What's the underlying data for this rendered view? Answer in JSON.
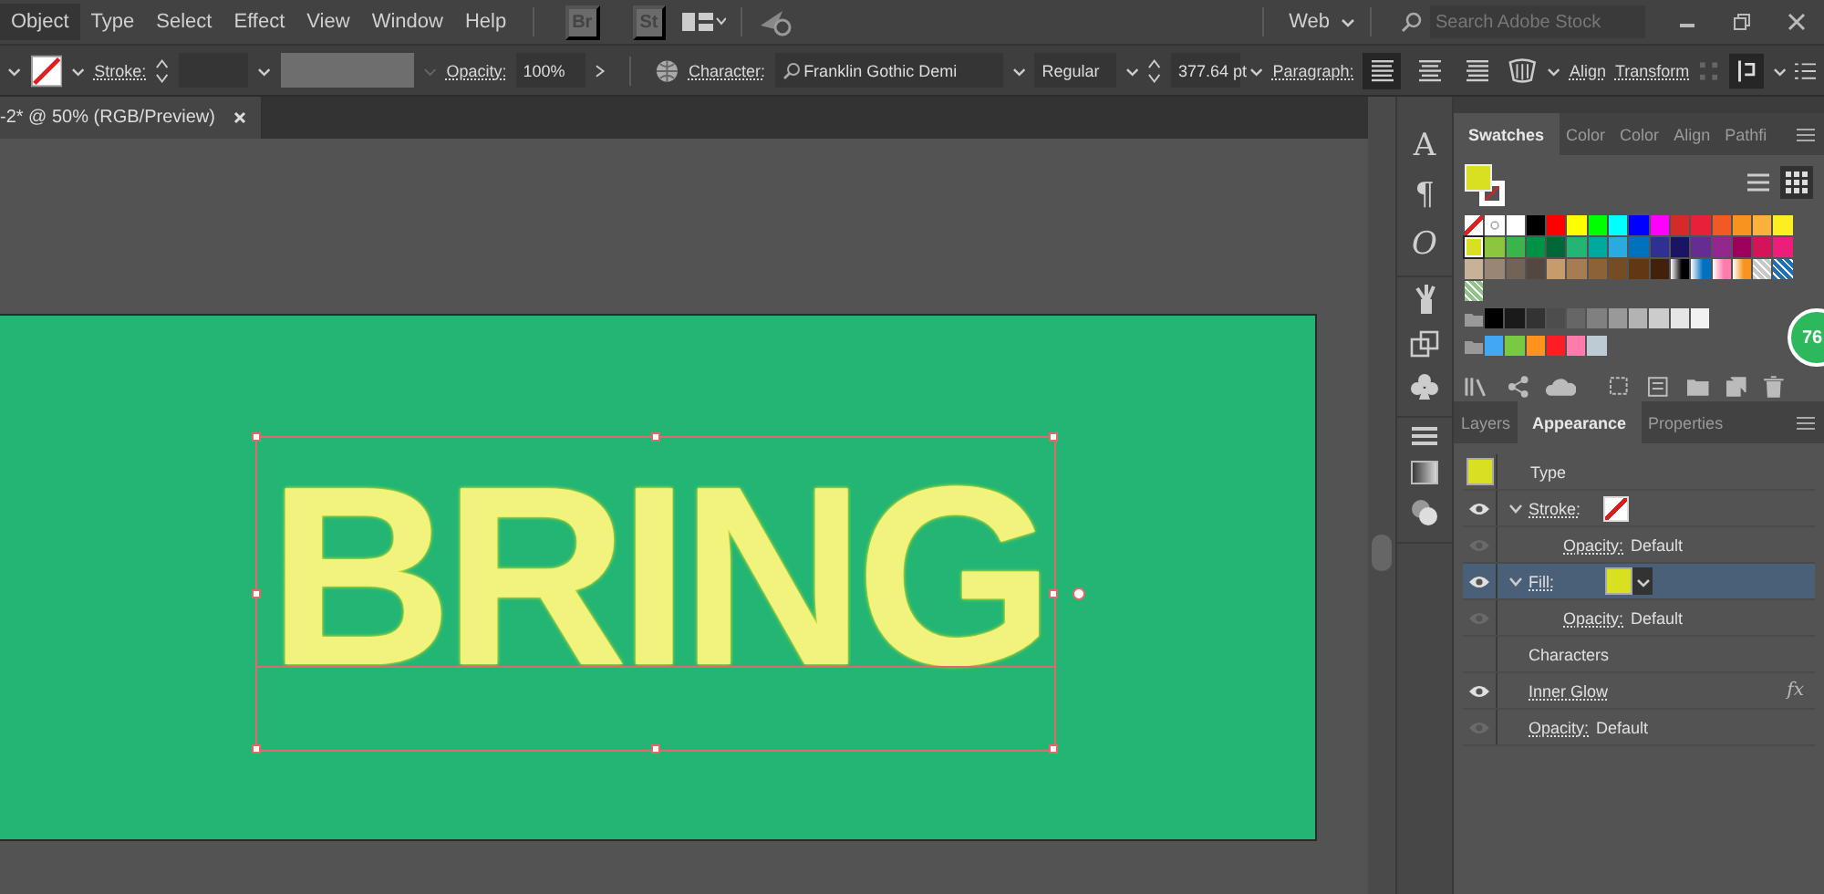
{
  "menu": [
    {
      "label": "Object",
      "selected": true
    },
    {
      "label": "Type",
      "selected": false
    },
    {
      "label": "Select",
      "selected": false
    },
    {
      "label": "Effect",
      "selected": false
    },
    {
      "label": "View",
      "selected": false
    },
    {
      "label": "Window",
      "selected": false
    },
    {
      "label": "Help",
      "selected": false
    }
  ],
  "apps": [
    "Br",
    "St"
  ],
  "workspace": "Web",
  "stock_search": {
    "placeholder": "Search Adobe Stock"
  },
  "control_bar": {
    "stroke_label": "Stroke:",
    "opacity_label": "Opacity:",
    "opacity": "100%",
    "character_label": "Character:",
    "font": "Franklin Gothic Demi",
    "style": "Regular",
    "size": "377.64 pt",
    "paragraph_label": "Paragraph:",
    "alignment": [
      {
        "selected": true
      },
      {
        "selected": false
      },
      {
        "selected": false
      }
    ],
    "align_link": "Align",
    "transform_link": "Transform"
  },
  "document_tab": {
    "title": "-2* @ 50% (RGB/Preview)"
  },
  "artboard": {
    "text": "BRING",
    "color": "#23b574"
  },
  "dock_glyphs": [
    "A",
    "¶",
    "O"
  ],
  "swatches_tabs": [
    {
      "label": "Swatches",
      "selected": true
    },
    {
      "label": "Color",
      "selected": false
    },
    {
      "label": "Color",
      "selected": false
    },
    {
      "label": "Align",
      "selected": false
    },
    {
      "label": "Pathfi",
      "selected": false
    }
  ],
  "swatches": {
    "current_fill": {
      "color": "#d9e021"
    },
    "rows": [
      {
        "folder": false,
        "swatches": [
          {
            "kind": "none",
            "selected": false
          },
          {
            "kind": "registration",
            "selected": false
          },
          {
            "kind": "color",
            "color": "#ffffff",
            "selected": false
          },
          {
            "kind": "color",
            "color": "#000000",
            "selected": false
          },
          {
            "kind": "color",
            "color": "#ff0000",
            "selected": false
          },
          {
            "kind": "color",
            "color": "#ffff00",
            "selected": false
          },
          {
            "kind": "color",
            "color": "#00ff00",
            "selected": false
          },
          {
            "kind": "color",
            "color": "#00ffff",
            "selected": false
          },
          {
            "kind": "color",
            "color": "#0000ff",
            "selected": false
          },
          {
            "kind": "color",
            "color": "#ff00ff",
            "selected": false
          },
          {
            "kind": "color",
            "color": "#d42a2a",
            "selected": false
          },
          {
            "kind": "color",
            "color": "#e8203a",
            "selected": false
          },
          {
            "kind": "color",
            "color": "#f15a24",
            "selected": false
          },
          {
            "kind": "color",
            "color": "#f7931e",
            "selected": false
          },
          {
            "kind": "color",
            "color": "#fbb03b",
            "selected": false
          },
          {
            "kind": "color",
            "color": "#fcee21",
            "selected": false
          }
        ]
      },
      {
        "folder": false,
        "swatches": [
          {
            "kind": "color",
            "color": "#d9e021",
            "selected": true
          },
          {
            "kind": "color",
            "color": "#8cc63f",
            "selected": false
          },
          {
            "kind": "color",
            "color": "#39b54a",
            "selected": false
          },
          {
            "kind": "color",
            "color": "#009245",
            "selected": false
          },
          {
            "kind": "color",
            "color": "#006837",
            "selected": false
          },
          {
            "kind": "color",
            "color": "#22b573",
            "selected": false
          },
          {
            "kind": "color",
            "color": "#00a99d",
            "selected": false
          },
          {
            "kind": "color",
            "color": "#29abe2",
            "selected": false
          },
          {
            "kind": "color",
            "color": "#0071bc",
            "selected": false
          },
          {
            "kind": "color",
            "color": "#2e3192",
            "selected": false
          },
          {
            "kind": "color",
            "color": "#1b1464",
            "selected": false
          },
          {
            "kind": "color",
            "color": "#662d91",
            "selected": false
          },
          {
            "kind": "color",
            "color": "#93278f",
            "selected": false
          },
          {
            "kind": "color",
            "color": "#9e005d",
            "selected": false
          },
          {
            "kind": "color",
            "color": "#d4145a",
            "selected": false
          },
          {
            "kind": "color",
            "color": "#ed1e79",
            "selected": false
          }
        ]
      },
      {
        "folder": false,
        "swatches": [
          {
            "kind": "color",
            "color": "#c7b299",
            "selected": false
          },
          {
            "kind": "color",
            "color": "#998675",
            "selected": false
          },
          {
            "kind": "color",
            "color": "#736357",
            "selected": false
          },
          {
            "kind": "color",
            "color": "#534741",
            "selected": false
          },
          {
            "kind": "color",
            "color": "#c69c6d",
            "selected": false
          },
          {
            "kind": "color",
            "color": "#a67c52",
            "selected": false
          },
          {
            "kind": "color",
            "color": "#8c6239",
            "selected": false
          },
          {
            "kind": "color",
            "color": "#754c24",
            "selected": false
          },
          {
            "kind": "color",
            "color": "#603813",
            "selected": false
          },
          {
            "kind": "color",
            "color": "#42210b",
            "selected": false
          },
          {
            "kind": "gradient",
            "color": "#000000",
            "selected": false
          },
          {
            "kind": "gradient",
            "color": "#0071bc",
            "selected": false
          },
          {
            "kind": "gradient",
            "color": "#ff7bac",
            "selected": false
          },
          {
            "kind": "gradient",
            "color": "#f7931e",
            "selected": false
          },
          {
            "kind": "pattern",
            "color": "#c8c8c8",
            "selected": false
          },
          {
            "kind": "pattern",
            "color": "#1f6fb8",
            "selected": false
          }
        ]
      },
      {
        "folder": false,
        "swatches": [
          {
            "kind": "pattern",
            "color": "#8fc38a",
            "selected": false
          }
        ]
      },
      {
        "folder": true,
        "swatches": [
          {
            "kind": "color",
            "color": "#000000",
            "selected": false
          },
          {
            "kind": "color",
            "color": "#1a1a1a",
            "selected": false
          },
          {
            "kind": "color",
            "color": "#333333",
            "selected": false
          },
          {
            "kind": "color",
            "color": "#4d4d4d",
            "selected": false
          },
          {
            "kind": "color",
            "color": "#666666",
            "selected": false
          },
          {
            "kind": "color",
            "color": "#808080",
            "selected": false
          },
          {
            "kind": "color",
            "color": "#999999",
            "selected": false
          },
          {
            "kind": "color",
            "color": "#b3b3b3",
            "selected": false
          },
          {
            "kind": "color",
            "color": "#cccccc",
            "selected": false
          },
          {
            "kind": "color",
            "color": "#e6e6e6",
            "selected": false
          },
          {
            "kind": "color",
            "color": "#f2f2f2",
            "selected": false
          }
        ]
      },
      {
        "folder": true,
        "swatches": [
          {
            "kind": "color",
            "color": "#3fa9f5",
            "selected": false
          },
          {
            "kind": "color",
            "color": "#7ac943",
            "selected": false
          },
          {
            "kind": "color",
            "color": "#ff931e",
            "selected": false
          },
          {
            "kind": "color",
            "color": "#ff1d25",
            "selected": false
          },
          {
            "kind": "color",
            "color": "#ff7bac",
            "selected": false
          },
          {
            "kind": "color",
            "color": "#bdccd4",
            "selected": false
          }
        ]
      }
    ]
  },
  "badge": "76",
  "appearance_tabs": [
    {
      "label": "Layers",
      "selected": false
    },
    {
      "label": "Appearance",
      "selected": true
    },
    {
      "label": "Properties",
      "selected": false
    }
  ],
  "appearance_rows": [
    {
      "kind": "object",
      "label": "Type",
      "color": "#d9e021"
    },
    {
      "kind": "stroke",
      "label": "Stroke:",
      "visible": true,
      "expanded": true,
      "selected": false,
      "children": [
        {
          "kind": "opacity",
          "label": "Opacity:",
          "value": "Default",
          "visible": false
        }
      ]
    },
    {
      "kind": "fill",
      "label": "Fill:",
      "color": "#d9e021",
      "visible": true,
      "expanded": true,
      "selected": true,
      "children": [
        {
          "kind": "opacity",
          "label": "Opacity:",
          "value": "Default",
          "visible": false
        }
      ]
    },
    {
      "kind": "characters",
      "label": "Characters"
    },
    {
      "kind": "effect",
      "label": "Inner Glow",
      "fx": "fx",
      "visible": true
    },
    {
      "kind": "opacity",
      "label": "Opacity:",
      "value": "Default",
      "visible": false
    }
  ]
}
